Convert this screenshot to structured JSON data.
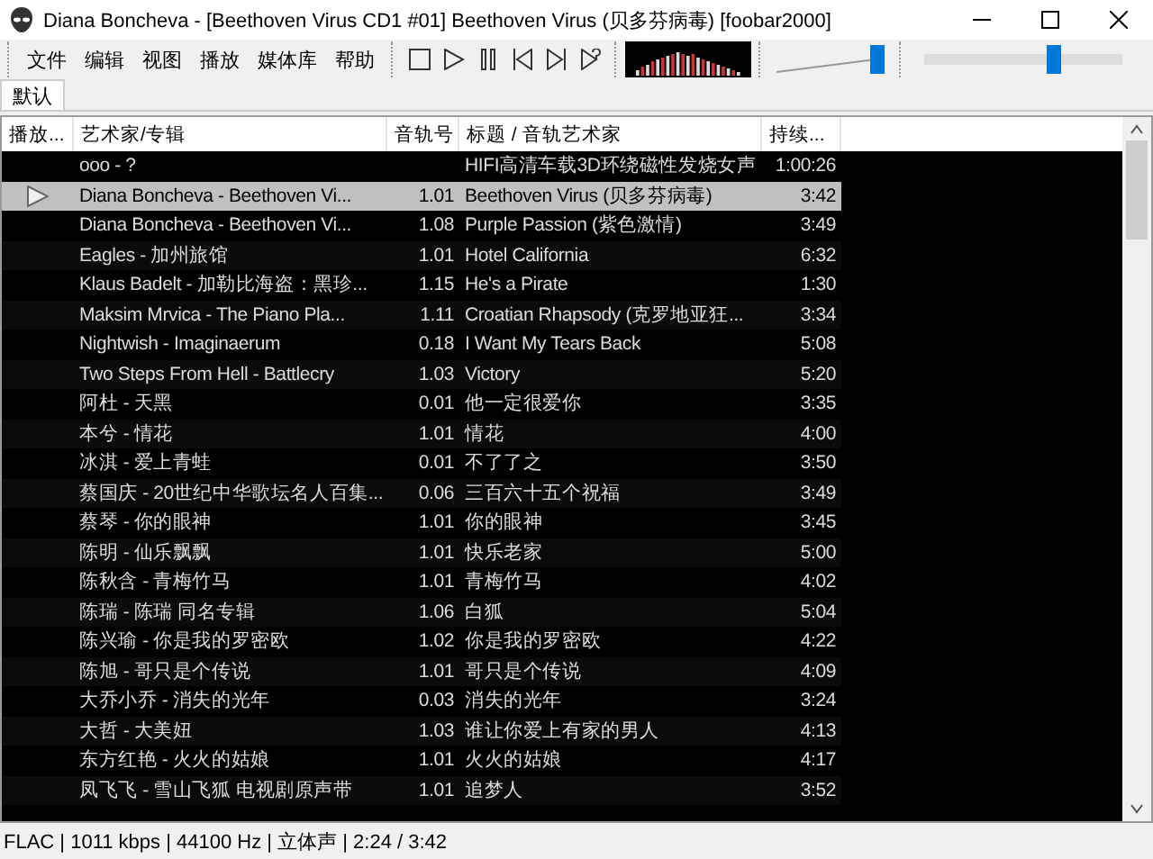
{
  "window": {
    "title": "Diana Boncheva - [Beethoven Virus CD1 #01] Beethoven Virus (贝多芬病毒)  [foobar2000]"
  },
  "menu": [
    "文件",
    "编辑",
    "视图",
    "播放",
    "媒体库",
    "帮助"
  ],
  "volume": {
    "level": 1.0
  },
  "seek": {
    "level": 0.65
  },
  "tabs": [
    {
      "label": "默认",
      "selected": true
    }
  ],
  "table": {
    "columns": [
      "播放...",
      "艺术家/专辑",
      "音轨号",
      "标题 / 音轨艺术家",
      "持续..."
    ],
    "rows": [
      {
        "artist": "ooo - ?",
        "track": "",
        "title": "HIFI高清车载3D环绕磁性发烧女声",
        "duration": "1:00:26",
        "selected": false,
        "playing": false
      },
      {
        "artist": "Diana Boncheva - Beethoven Vi...",
        "track": "1.01",
        "title": "Beethoven Virus (贝多芬病毒)",
        "duration": "3:42",
        "selected": true,
        "playing": true
      },
      {
        "artist": "Diana Boncheva - Beethoven Vi...",
        "track": "1.08",
        "title": "Purple Passion (紫色激情)",
        "duration": "3:49",
        "selected": false,
        "playing": false
      },
      {
        "artist": "Eagles - 加州旅馆",
        "track": "1.01",
        "title": "Hotel California",
        "duration": "6:32",
        "selected": false,
        "playing": false
      },
      {
        "artist": "Klaus Badelt - 加勒比海盗：黑珍...",
        "track": "1.15",
        "title": "He's a Pirate",
        "duration": "1:30",
        "selected": false,
        "playing": false
      },
      {
        "artist": "Maksim Mrvica - The Piano Pla...",
        "track": "1.11",
        "title": "Croatian Rhapsody (克罗地亚狂...",
        "duration": "3:34",
        "selected": false,
        "playing": false
      },
      {
        "artist": "Nightwish - Imaginaerum",
        "track": "0.18",
        "title": "I Want My Tears Back",
        "duration": "5:08",
        "selected": false,
        "playing": false
      },
      {
        "artist": "Two Steps From Hell - Battlecry",
        "track": "1.03",
        "title": "Victory",
        "duration": "5:20",
        "selected": false,
        "playing": false
      },
      {
        "artist": "阿杜 - 天黑",
        "track": "0.01",
        "title": "他一定很爱你",
        "duration": "3:35",
        "selected": false,
        "playing": false
      },
      {
        "artist": "本兮 - 情花",
        "track": "1.01",
        "title": "情花",
        "duration": "4:00",
        "selected": false,
        "playing": false
      },
      {
        "artist": "冰淇 - 爱上青蛙",
        "track": "0.01",
        "title": "不了了之",
        "duration": "3:50",
        "selected": false,
        "playing": false
      },
      {
        "artist": "蔡国庆 - 20世纪中华歌坛名人百集...",
        "track": "0.06",
        "title": "三百六十五个祝福",
        "duration": "3:49",
        "selected": false,
        "playing": false
      },
      {
        "artist": "蔡琴 - 你的眼神",
        "track": "1.01",
        "title": "你的眼神",
        "duration": "3:45",
        "selected": false,
        "playing": false
      },
      {
        "artist": "陈明 - 仙乐飘飘",
        "track": "1.01",
        "title": "快乐老家",
        "duration": "5:00",
        "selected": false,
        "playing": false
      },
      {
        "artist": "陈秋含 - 青梅竹马",
        "track": "1.01",
        "title": "青梅竹马",
        "duration": "4:02",
        "selected": false,
        "playing": false
      },
      {
        "artist": "陈瑞 - 陈瑞 同名专辑",
        "track": "1.06",
        "title": "白狐",
        "duration": "5:04",
        "selected": false,
        "playing": false
      },
      {
        "artist": "陈兴瑜 - 你是我的罗密欧",
        "track": "1.02",
        "title": "你是我的罗密欧",
        "duration": "4:22",
        "selected": false,
        "playing": false
      },
      {
        "artist": "陈旭 - 哥只是个传说",
        "track": "1.01",
        "title": "哥只是个传说",
        "duration": "4:09",
        "selected": false,
        "playing": false
      },
      {
        "artist": "大乔小乔 - 消失的光年",
        "track": "0.03",
        "title": "消失的光年",
        "duration": "3:24",
        "selected": false,
        "playing": false
      },
      {
        "artist": "大哲 - 大美妞",
        "track": "1.03",
        "title": "谁让你爱上有家的男人",
        "duration": "4:13",
        "selected": false,
        "playing": false
      },
      {
        "artist": "东方红艳 - 火火的姑娘",
        "track": "1.01",
        "title": "火火的姑娘",
        "duration": "4:17",
        "selected": false,
        "playing": false
      },
      {
        "artist": "凤飞飞 - 雪山飞狐 电视剧原声带",
        "track": "1.01",
        "title": "追梦人",
        "duration": "3:52",
        "selected": false,
        "playing": false
      }
    ]
  },
  "status_bar": "FLAC | 1011 kbps | 44100 Hz | 立体声 | 2:24 / 3:42"
}
